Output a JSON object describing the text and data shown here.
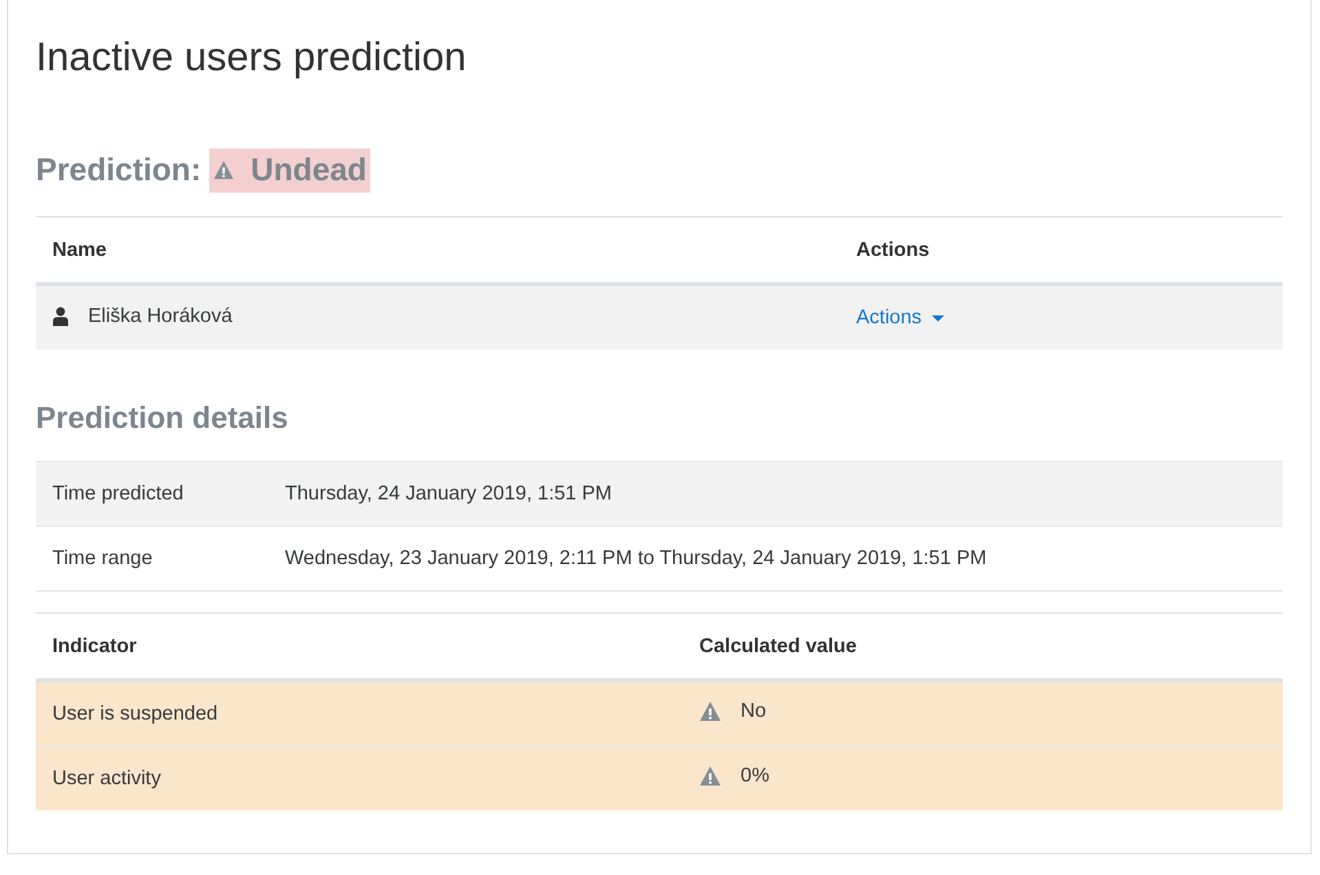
{
  "page_title": "Inactive users prediction",
  "prediction": {
    "label": "Prediction:",
    "value": "Undead",
    "warning": true
  },
  "users_table": {
    "columns": [
      "Name",
      "Actions"
    ],
    "rows": [
      {
        "name": "Eliška Horáková",
        "action": "Actions"
      }
    ]
  },
  "details": {
    "heading": "Prediction details",
    "rows": [
      {
        "label": "Time predicted",
        "value": "Thursday, 24 January 2019, 1:51 PM"
      },
      {
        "label": "Time range",
        "value": "Wednesday, 23 January 2019, 2:11 PM to Thursday, 24 January 2019, 1:51 PM"
      }
    ]
  },
  "indicators": {
    "columns": [
      "Indicator",
      "Calculated value"
    ],
    "rows": [
      {
        "name": "User is suspended",
        "value": "No",
        "warning": true
      },
      {
        "name": "User activity",
        "value": "0%",
        "warning": true
      }
    ]
  }
}
